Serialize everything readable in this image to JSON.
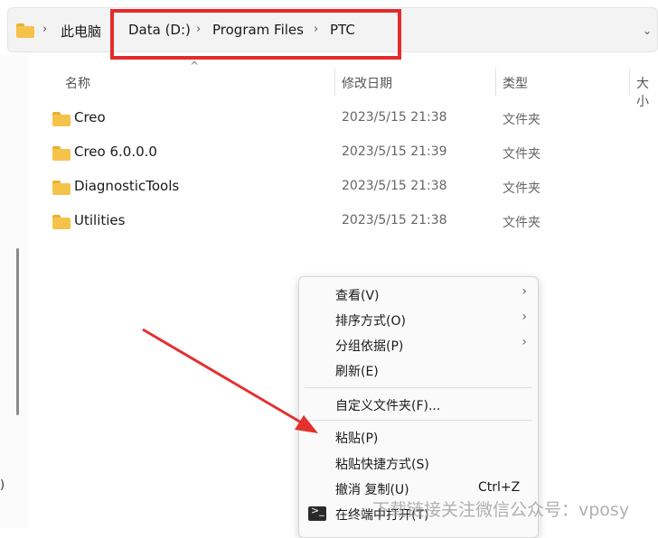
{
  "address_bar": {
    "root_label": "此电脑",
    "crumbs": [
      "Data (D:)",
      "Program Files",
      "PTC"
    ]
  },
  "columns": {
    "name": "名称",
    "modified": "修改日期",
    "type": "类型",
    "size": "大小"
  },
  "files": [
    {
      "name": "Creo",
      "date": "2023/5/15 21:38",
      "type": "文件夹"
    },
    {
      "name": "Creo 6.0.0.0",
      "date": "2023/5/15 21:39",
      "type": "文件夹"
    },
    {
      "name": "DiagnosticTools",
      "date": "2023/5/15 21:38",
      "type": "文件夹"
    },
    {
      "name": "Utilities",
      "date": "2023/5/15 21:38",
      "type": "文件夹"
    }
  ],
  "left_nav": {
    "letter": ")"
  },
  "context_menu": {
    "items": [
      {
        "label": "查看(V)",
        "submenu": true
      },
      {
        "label": "排序方式(O)",
        "submenu": true
      },
      {
        "label": "分组依据(P)",
        "submenu": true
      },
      {
        "label": "刷新(E)"
      },
      {
        "label": "自定义文件夹(F)..."
      },
      {
        "label": "粘贴(P)"
      },
      {
        "label": "粘贴快捷方式(S)"
      },
      {
        "label": "撤消 复制(U)",
        "shortcut": "Ctrl+Z"
      },
      {
        "label": "在终端中打开(T)"
      }
    ]
  },
  "watermark": "下载链接关注微信公众号：vposy",
  "colors": {
    "highlight": "#e32b2b",
    "folder": "#f6c34a"
  }
}
